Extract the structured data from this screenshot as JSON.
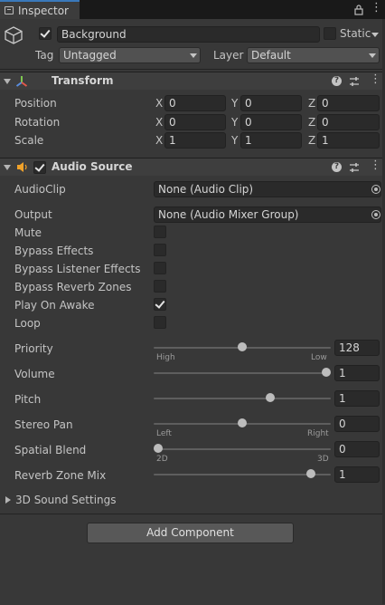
{
  "tab": {
    "title": "Inspector"
  },
  "header": {
    "active": true,
    "name": "Background",
    "static_label": "Static",
    "tag_label": "Tag",
    "tag_value": "Untagged",
    "layer_label": "Layer",
    "layer_value": "Default"
  },
  "transform": {
    "title": "Transform",
    "rows": [
      {
        "label": "Position",
        "x": "0",
        "y": "0",
        "z": "0"
      },
      {
        "label": "Rotation",
        "x": "0",
        "y": "0",
        "z": "0"
      },
      {
        "label": "Scale",
        "x": "1",
        "y": "1",
        "z": "1"
      }
    ],
    "axis": {
      "x": "X",
      "y": "Y",
      "z": "Z"
    }
  },
  "audio": {
    "title": "Audio Source",
    "enabled": true,
    "clip_label": "AudioClip",
    "clip_value": "None (Audio Clip)",
    "output_label": "Output",
    "output_value": "None (Audio Mixer Group)",
    "toggles": [
      {
        "label": "Mute",
        "checked": false
      },
      {
        "label": "Bypass Effects",
        "checked": false
      },
      {
        "label": "Bypass Listener Effects",
        "checked": false
      },
      {
        "label": "Bypass Reverb Zones",
        "checked": false
      },
      {
        "label": "Play On Awake",
        "checked": true
      },
      {
        "label": "Loop",
        "checked": false
      }
    ],
    "priority": {
      "label": "Priority",
      "value": "128",
      "fraction": 0.5,
      "min_label": "High",
      "max_label": "Low"
    },
    "volume": {
      "label": "Volume",
      "value": "1",
      "fraction": 1.0
    },
    "pitch": {
      "label": "Pitch",
      "value": "1",
      "fraction": 0.667
    },
    "stereo_pan": {
      "label": "Stereo Pan",
      "value": "0",
      "fraction": 0.5,
      "min_label": "Left",
      "max_label": "Right"
    },
    "spatial_blend": {
      "label": "Spatial Blend",
      "value": "0",
      "fraction": 0.0,
      "min_label": "2D",
      "max_label": "3D"
    },
    "reverb_zone_mix": {
      "label": "Reverb Zone Mix",
      "value": "1",
      "fraction": 0.909
    },
    "sound_settings_label": "3D Sound Settings"
  },
  "add_component_label": "Add Component",
  "colors": {
    "accent": "#3a79bb",
    "background": "#383838"
  }
}
